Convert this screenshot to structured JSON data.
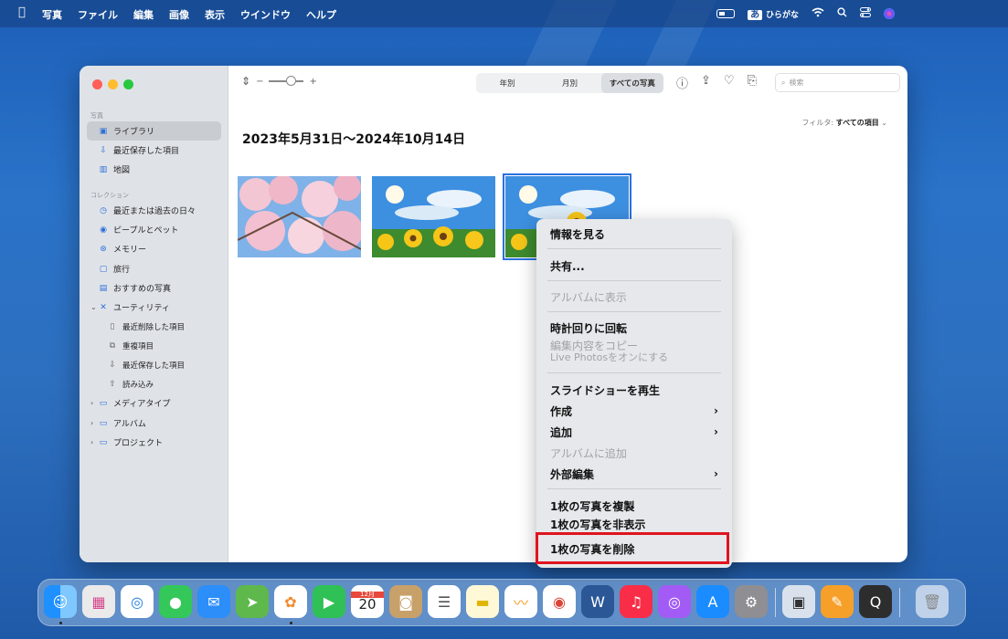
{
  "menubar": {
    "items": [
      "写真",
      "ファイル",
      "編集",
      "画像",
      "表示",
      "ウインドウ",
      "ヘルプ"
    ],
    "ime_mark": "あ",
    "ime_label": "ひらがな"
  },
  "toolbar": {
    "segments": [
      "年別",
      "月別",
      "すべての写真"
    ],
    "search_placeholder": "検索"
  },
  "sidebar": {
    "section_photos": "写真",
    "library": "ライブラリ",
    "recently_saved": "最近保存した項目",
    "map": "地図",
    "section_collections": "コレクション",
    "recent_days": "最近または過去の日々",
    "people_pets": "ピープルとペット",
    "memories": "メモリー",
    "trips": "旅行",
    "featured": "おすすめの写真",
    "utilities": "ユーティリティ",
    "recently_deleted": "最近削除した項目",
    "duplicates": "重複項目",
    "recently_saved_2": "最近保存した項目",
    "imports": "読み込み",
    "media_types": "メディアタイプ",
    "albums": "アルバム",
    "projects": "プロジェクト"
  },
  "main": {
    "heading": "2023年5月31日〜2024年10月14日",
    "filter_label": "フィルタ:",
    "filter_value": "すべての項目"
  },
  "context_menu": {
    "info": "情報を見る",
    "share": "共有...",
    "show_in_album": "アルバムに表示",
    "rotate_cw": "時計回りに回転",
    "copy_edits": "編集内容をコピー",
    "live_photos": "Live Photosをオンにする",
    "slideshow": "スライドショーを再生",
    "create": "作成",
    "add": "追加",
    "add_to_album": "アルバムに追加",
    "external_edit": "外部編集",
    "duplicate": "1枚の写真を複製",
    "hide": "1枚の写真を非表示",
    "delete": "1枚の写真を削除"
  },
  "dock": {
    "calendar_month": "12月",
    "calendar_day": "20"
  }
}
